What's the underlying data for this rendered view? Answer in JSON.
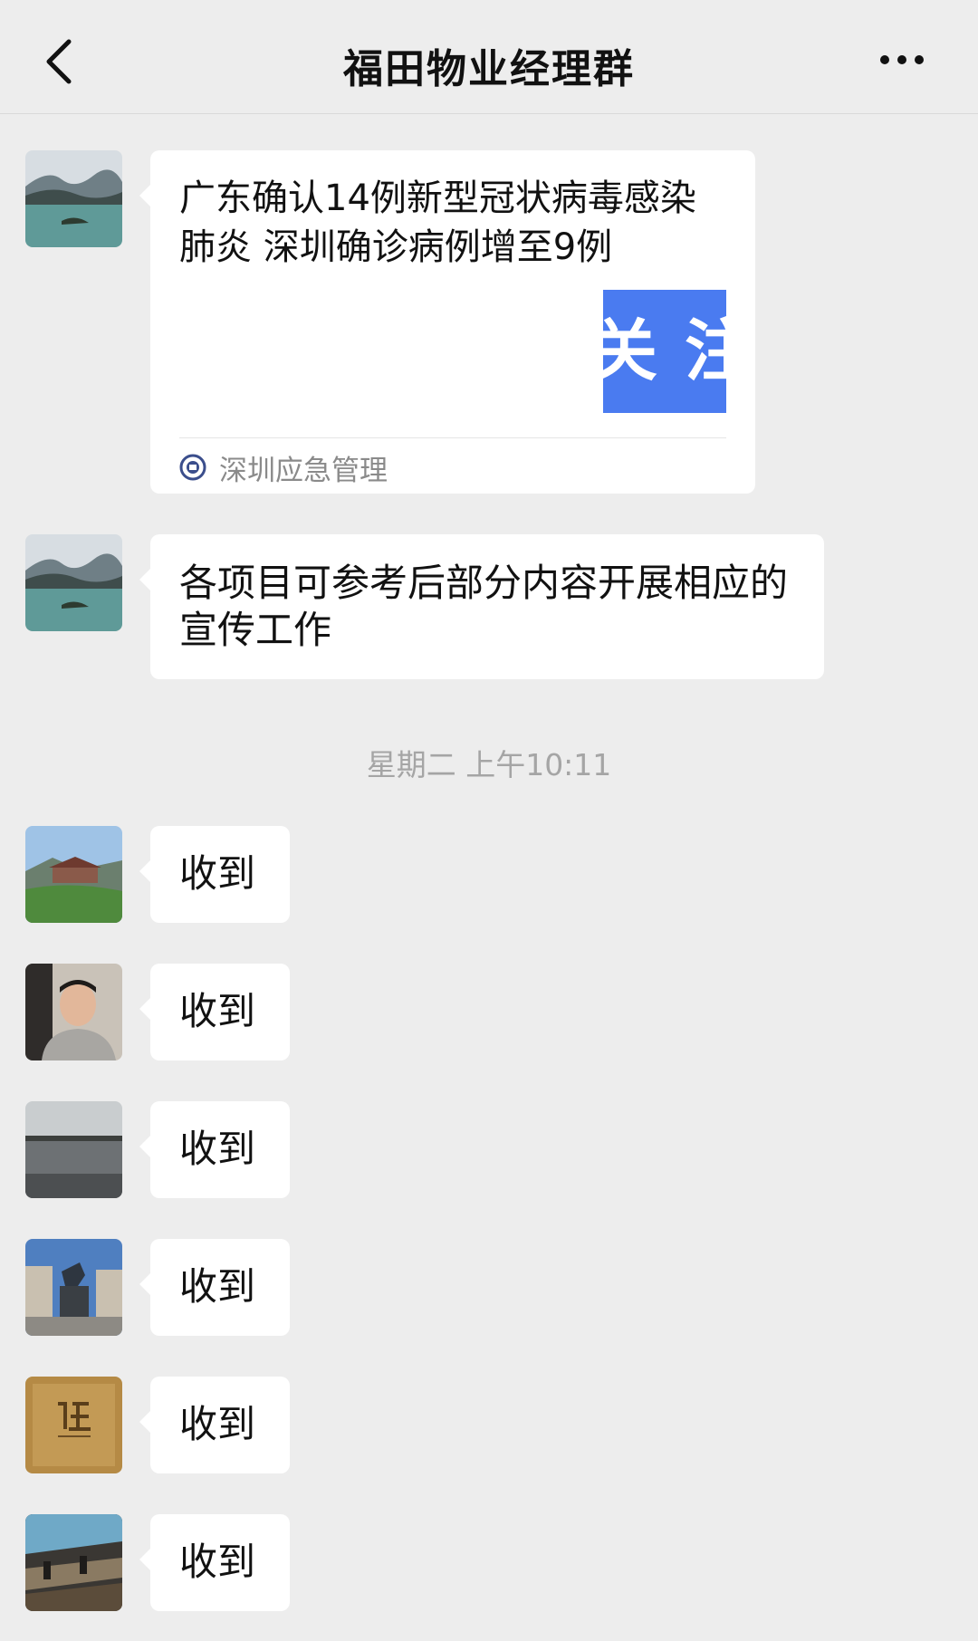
{
  "header": {
    "title": "福田物业经理群"
  },
  "messages": [
    {
      "type": "link",
      "title": "广东确认14例新型冠状病毒感染肺炎 深圳确诊病例增至9例",
      "thumb_text": "关注",
      "source": "深圳应急管理"
    },
    {
      "type": "text",
      "text": "各项目可参考后部分内容开展相应的宣传工作"
    }
  ],
  "timestamp": "星期二 上午10:11",
  "replies": [
    {
      "text": "收到"
    },
    {
      "text": "收到"
    },
    {
      "text": "收到"
    },
    {
      "text": "收到"
    },
    {
      "text": "收到"
    },
    {
      "text": "收到"
    }
  ],
  "colors": {
    "background": "#ededed",
    "bubble": "#ffffff",
    "thumb": "#4a7bf0"
  }
}
